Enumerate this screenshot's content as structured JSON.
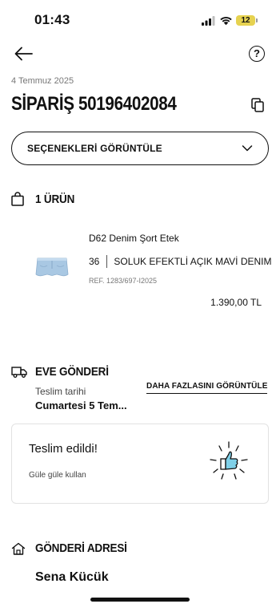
{
  "status_bar": {
    "time": "01:43",
    "battery": "12"
  },
  "header": {
    "help_label": "?"
  },
  "order": {
    "date": "4 Temmuz 2025",
    "title": "SİPARİŞ 50196402084",
    "options_label": "SEÇENEKLERİ GÖRÜNTÜLE"
  },
  "items_section": {
    "heading": "1 ÜRÜN",
    "product": {
      "name": "D62 Denim Şort Etek",
      "size": "36",
      "color": "SOLUK EFEKTLİ AÇIK MAVİ DENIM",
      "ref": "REF. 1283/697-I2025",
      "price": "1.390,00 TL"
    }
  },
  "delivery_section": {
    "heading": "EVE GÖNDERİ",
    "date_label": "Teslim tarihi",
    "date_value": "Cumartesi 5 Tem...",
    "more_link": "DAHA FAZLASINI GÖRÜNTÜLE"
  },
  "status_card": {
    "title": "Teslim edildi!",
    "subtitle": "Güle güle kullan"
  },
  "address_section": {
    "heading": "GÖNDERİ ADRESİ",
    "recipient": "Sena Kücük"
  },
  "colors": {
    "text": "#111111",
    "muted": "#777777",
    "border": "#e2e2e2",
    "battery": "#e6d250",
    "denim": "#a9c8e3"
  },
  "icons": [
    "back-arrow-icon",
    "help-icon",
    "copy-icon",
    "chevron-down-icon",
    "shopping-bag-icon",
    "delivery-truck-icon",
    "thumbs-up-icon",
    "home-icon"
  ]
}
